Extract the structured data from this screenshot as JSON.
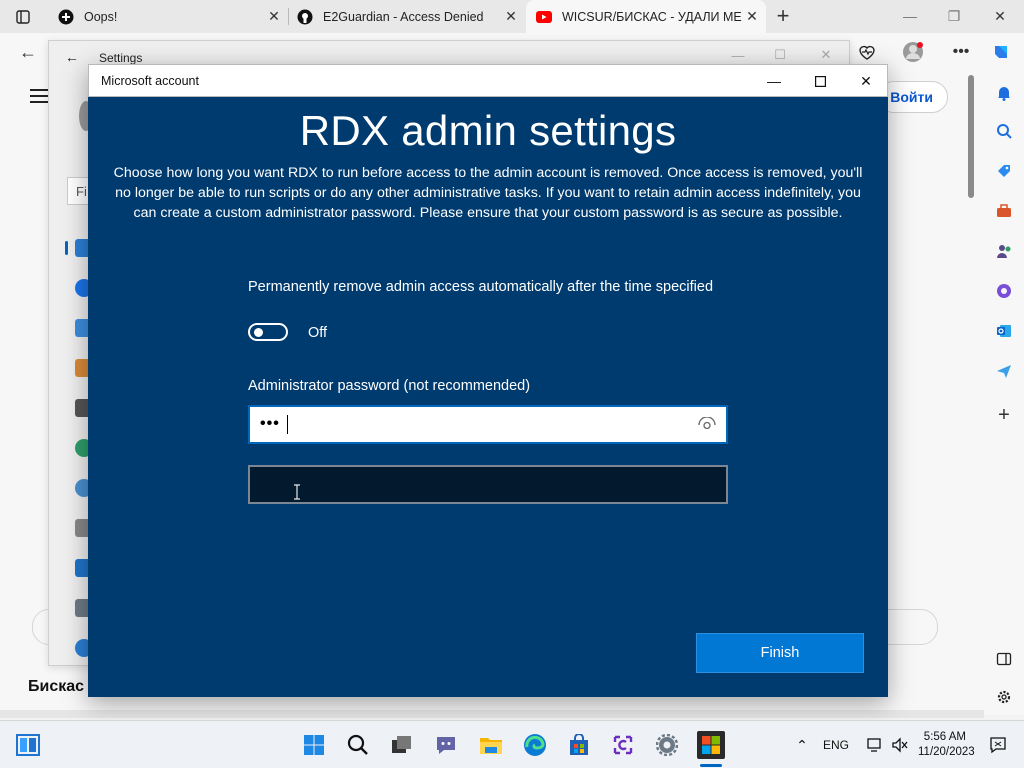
{
  "browser": {
    "tabs": [
      {
        "title": "Oops!",
        "active": false
      },
      {
        "title": "E2Guardian - Access Denied",
        "active": false
      },
      {
        "title": "WICSUR/БИСКАС - УДАЛИ МЕН",
        "active": true
      }
    ],
    "page_button_label": "Войти"
  },
  "settings_window": {
    "title": "Settings",
    "search_placeholder_fragment": "Fi"
  },
  "dialog": {
    "window_title": "Microsoft account",
    "heading": "RDX admin settings",
    "description": "Choose how long you want RDX to run before access to the admin account is removed. Once access is removed, you'll no longer be able to run scripts or do any other administrative tasks. If you want to retain admin access indefinitely, you can create a custom administrator password. Please ensure that your custom password is as secure as possible.",
    "toggle_label": "Permanently remove admin access automatically after the time specified",
    "toggle_state": "Off",
    "toggle_on": false,
    "password_label": "Administrator password (not recommended)",
    "password_value": "•••",
    "confirm_value": "",
    "finish_label": "Finish",
    "colors": {
      "body": "#003b6f",
      "button": "#0078d4",
      "input_border": "#0067c0"
    }
  },
  "page": {
    "bottom_text": "Бискас"
  },
  "taskbar": {
    "language": "ENG",
    "time": "5:56 AM",
    "date": "11/20/2023",
    "icons": [
      "widgets-icon",
      "start-icon",
      "search-icon",
      "task-view-icon",
      "teams-chat-icon",
      "file-explorer-icon",
      "edge-icon",
      "store-icon",
      "clipchamp-icon",
      "settings-icon",
      "microsoft-icon"
    ]
  }
}
